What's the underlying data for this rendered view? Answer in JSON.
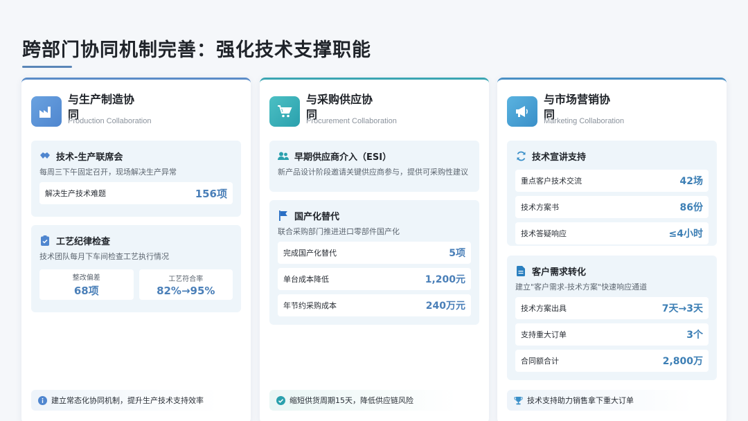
{
  "page": {
    "title": "跨部门协同机制完善：强化技术支撑职能"
  },
  "columns": [
    {
      "name": "与生产制造协同",
      "en": "Production Collaboration",
      "icon": "factory-icon",
      "cards": [
        {
          "title": "技术-生产联席会",
          "icon": "handshake-icon",
          "desc": "每周三下午固定召开，现场解决生产异常",
          "rows": [
            {
              "k": "解决生产技术难题",
              "v": "156项"
            }
          ]
        },
        {
          "title": "工艺纪律检查",
          "icon": "clipboard-check-icon",
          "desc": "技术团队每月下车间检查工艺执行情况",
          "pairs": [
            {
              "k": "整改偏差",
              "v": "68项"
            },
            {
              "k": "工艺符合率",
              "v": "82%→95%"
            }
          ]
        }
      ],
      "footer": {
        "icon": "info-icon",
        "text": "建立常态化协同机制，提升生产技术支持效率"
      }
    },
    {
      "name": "与采购供应协同",
      "en": "Procurement Collaboration",
      "icon": "cart-icon",
      "cards": [
        {
          "title": "早期供应商介入（ESI）",
          "icon": "users-icon",
          "desc": "新产品设计阶段邀请关键供应商参与，提供可采购性建议",
          "rows": []
        },
        {
          "title": "国产化替代",
          "icon": "flag-icon",
          "desc": "联合采购部门推进进口零部件国产化",
          "rows": [
            {
              "k": "完成国产化替代",
              "v": "5项"
            },
            {
              "k": "单台成本降低",
              "v": "1,200元"
            },
            {
              "k": "年节约采购成本",
              "v": "240万元"
            }
          ]
        }
      ],
      "footer": {
        "icon": "check-circle-icon",
        "text": "缩短供货周期15天，降低供应链风险"
      }
    },
    {
      "name": "与市场营销协同",
      "en": "Marketing Collaboration",
      "icon": "megaphone-icon",
      "cards": [
        {
          "title": "技术宣讲支持",
          "icon": "sync-icon",
          "desc": "",
          "rows": [
            {
              "k": "重点客户技术交流",
              "v": "42场"
            },
            {
              "k": "技术方案书",
              "v": "86份"
            },
            {
              "k": "技术答疑响应",
              "v": "≤4小时"
            }
          ]
        },
        {
          "title": "客户需求转化",
          "icon": "document-icon",
          "desc": "建立\"客户需求-技术方案\"快速响应通道",
          "rows": [
            {
              "k": "技术方案出具",
              "v": "7天→3天"
            },
            {
              "k": "支持重大订单",
              "v": "3个"
            },
            {
              "k": "合同额合计",
              "v": "2,800万"
            }
          ]
        }
      ],
      "footer": {
        "icon": "trophy-icon",
        "text": "技术支持助力销售拿下重大订单"
      }
    }
  ]
}
